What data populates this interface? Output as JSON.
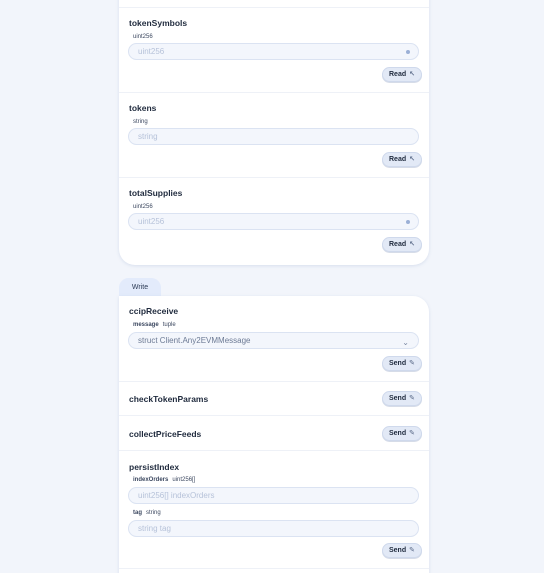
{
  "read_section": {
    "functions": [
      {
        "name": "tokenSymbols",
        "param_type": "uint256",
        "placeholder": "uint256",
        "button": "Read",
        "button_icon": "cursor-icon"
      },
      {
        "name": "tokens",
        "param_type": "string",
        "placeholder": "string",
        "button": "Read",
        "button_icon": "cursor-icon"
      },
      {
        "name": "totalSupplies",
        "param_type": "uint256",
        "placeholder": "uint256",
        "button": "Read",
        "button_icon": "cursor-icon"
      }
    ]
  },
  "write_tab": {
    "label": "Write"
  },
  "write_section": {
    "ccipReceive": {
      "name": "ccipReceive",
      "param_name": "message",
      "param_type": "tuple",
      "select_value": "struct Client.Any2EVMMessage",
      "button": "Send"
    },
    "checkTokenParams": {
      "name": "checkTokenParams",
      "button": "Send"
    },
    "collectPriceFeeds": {
      "name": "collectPriceFeeds",
      "button": "Send"
    },
    "persistIndex": {
      "name": "persistIndex",
      "params": [
        {
          "name": "indexOrders",
          "type": "uint256[]",
          "placeholder": "uint256[] indexOrders"
        },
        {
          "name": "tag",
          "type": "string",
          "placeholder": "string tag"
        }
      ],
      "button": "Send"
    }
  },
  "icons": {
    "read": "cursor-icon",
    "send": "send-icon",
    "number_indicator": "dot-icon",
    "dropdown": "chevron-down-icon"
  }
}
